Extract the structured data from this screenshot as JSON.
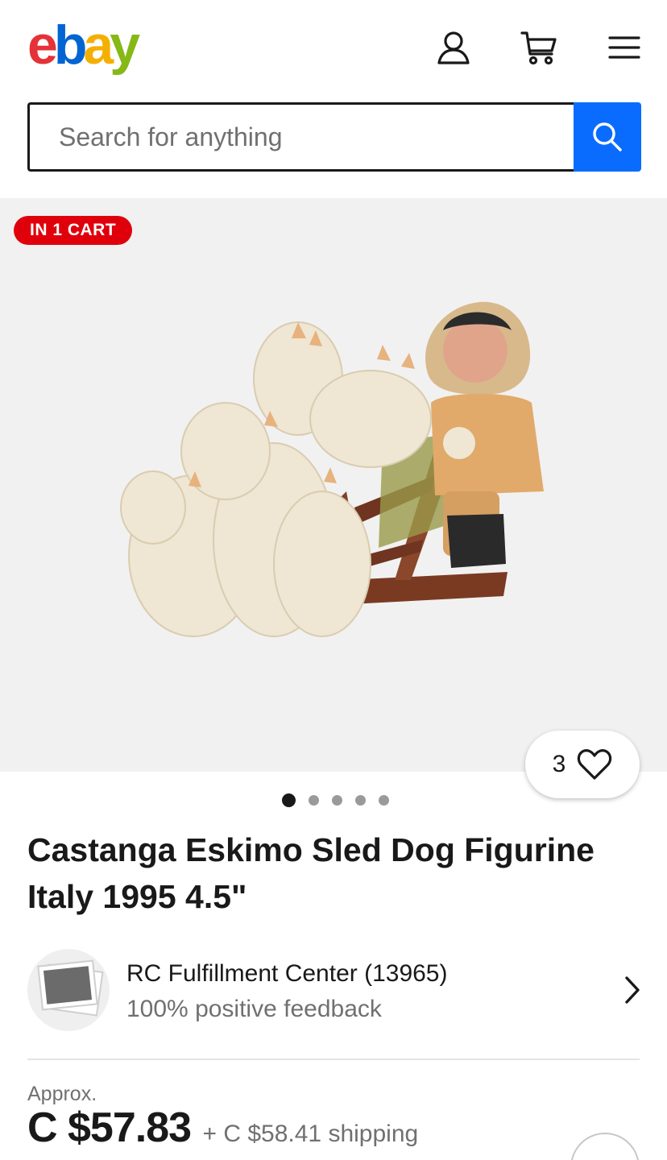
{
  "header": {
    "logo_letters": [
      "e",
      "b",
      "a",
      "y"
    ],
    "logo_colors": [
      "#e53238",
      "#0064d2",
      "#f5af02",
      "#86b817"
    ],
    "icons": [
      "account-icon",
      "cart-icon",
      "menu-icon"
    ]
  },
  "search": {
    "placeholder": "Search for anything",
    "button_icon": "search-icon",
    "accent": "#0a6cff"
  },
  "gallery": {
    "badge": "IN 1 CART",
    "badge_color": "#e0000b",
    "watch_count": "3",
    "watch_icon": "heart-icon",
    "image_count": 5,
    "active_image": 1
  },
  "listing": {
    "title": "Castanga Eskimo Sled Dog Figurine Italy 1995 4.5\""
  },
  "seller": {
    "name": "RC Fulfillment Center (13965)",
    "feedback": "100% positive feedback"
  },
  "price": {
    "approx_label": "Approx.",
    "amount": "C $57.83",
    "shipping": "+ C $58.41 shipping"
  }
}
